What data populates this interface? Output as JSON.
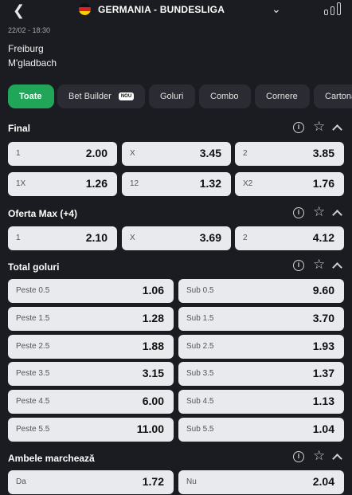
{
  "header": {
    "title": "GERMANIA - BUNDESLIGA"
  },
  "match": {
    "date": "22/02 - 18:30",
    "home": "Freiburg",
    "away": "M'gladbach"
  },
  "tabs": [
    {
      "label": "Toate",
      "active": true
    },
    {
      "label": "Bet Builder",
      "badge": "NOU"
    },
    {
      "label": "Goluri"
    },
    {
      "label": "Combo"
    },
    {
      "label": "Cornere"
    },
    {
      "label": "Cartonase"
    }
  ],
  "sections": {
    "final": {
      "title": "Final",
      "rows": [
        [
          {
            "label": "1",
            "odd": "2.00"
          },
          {
            "label": "X",
            "odd": "3.45"
          },
          {
            "label": "2",
            "odd": "3.85"
          }
        ],
        [
          {
            "label": "1X",
            "odd": "1.26"
          },
          {
            "label": "12",
            "odd": "1.32"
          },
          {
            "label": "X2",
            "odd": "1.76"
          }
        ]
      ]
    },
    "oferta": {
      "title": "Oferta Max (+4)",
      "rows": [
        [
          {
            "label": "1",
            "odd": "2.10"
          },
          {
            "label": "X",
            "odd": "3.69"
          },
          {
            "label": "2",
            "odd": "4.12"
          }
        ]
      ]
    },
    "total": {
      "title": "Total goluri",
      "rows": [
        [
          {
            "label": "Peste 0.5",
            "odd": "1.06"
          },
          {
            "label": "Sub 0.5",
            "odd": "9.60"
          }
        ],
        [
          {
            "label": "Peste 1.5",
            "odd": "1.28"
          },
          {
            "label": "Sub 1.5",
            "odd": "3.70"
          }
        ],
        [
          {
            "label": "Peste 2.5",
            "odd": "1.88"
          },
          {
            "label": "Sub 2.5",
            "odd": "1.93"
          }
        ],
        [
          {
            "label": "Peste 3.5",
            "odd": "3.15"
          },
          {
            "label": "Sub 3.5",
            "odd": "1.37"
          }
        ],
        [
          {
            "label": "Peste 4.5",
            "odd": "6.00"
          },
          {
            "label": "Sub 4.5",
            "odd": "1.13"
          }
        ],
        [
          {
            "label": "Peste 5.5",
            "odd": "11.00"
          },
          {
            "label": "Sub 5.5",
            "odd": "1.04"
          }
        ]
      ]
    },
    "ambele": {
      "title": "Ambele marchează",
      "rows": [
        [
          {
            "label": "Da",
            "odd": "1.72"
          },
          {
            "label": "Nu",
            "odd": "2.04"
          }
        ]
      ]
    }
  },
  "colors": {
    "background": "#1b1c21",
    "active_tab": "#21a558",
    "odd_button": "#e9eaee",
    "tab": "#2b2c33"
  },
  "icons": [
    "back-arrow-icon",
    "germany-flag-icon",
    "chevron-down-icon",
    "stats-icon",
    "info-icon",
    "star-icon",
    "collapse-icon"
  ]
}
